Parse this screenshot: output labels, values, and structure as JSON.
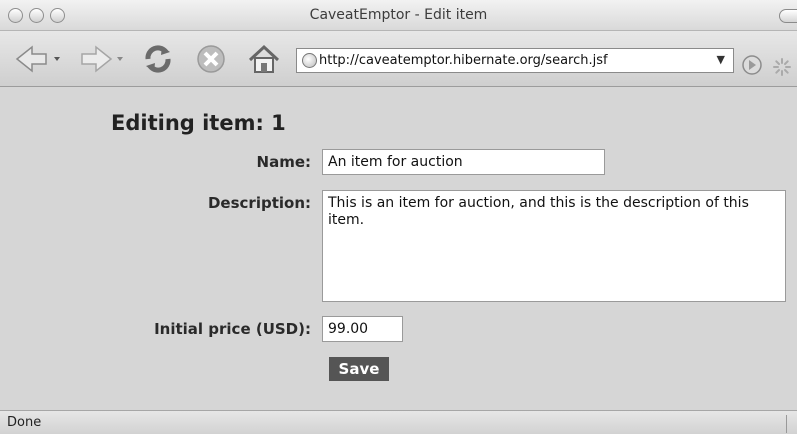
{
  "window": {
    "title": "CaveatEmptor - Edit item"
  },
  "toolbar": {
    "url": "http://caveatemptor.hibernate.org/search.jsf",
    "icons": [
      "back-arrow-icon",
      "forward-arrow-icon",
      "reload-icon",
      "stop-icon",
      "home-icon",
      "globe-icon",
      "dropdown-arrow-icon",
      "go-icon",
      "activity-spinner-icon"
    ]
  },
  "page": {
    "heading": "Editing item: 1",
    "name_label": "Name:",
    "name_value": "An item for auction",
    "description_label": "Description:",
    "description_value": "This is an item for auction, and this is the description of this item.",
    "price_label": "Initial price (USD):",
    "price_value": "99.00",
    "save_label": "Save"
  },
  "status": {
    "text": "Done"
  }
}
